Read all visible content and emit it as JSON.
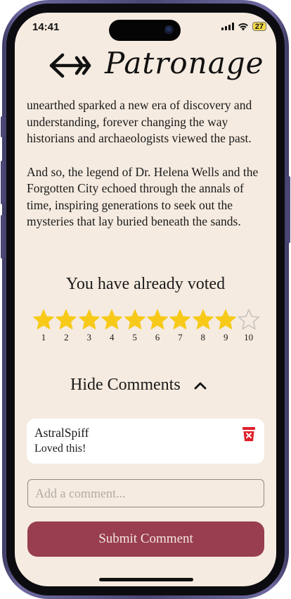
{
  "status_bar": {
    "time": "14:41",
    "battery": "27",
    "battery_color": "#f3d94a"
  },
  "header": {
    "title": "Patronage",
    "back_icon": "double-back-arrow-icon"
  },
  "story": {
    "paragraphs": [
      "unearthed sparked a new era of discovery and understanding, forever changing the way historians and archaeologists viewed the past.",
      "And so, the legend of Dr. Helena Wells and the Forgotten City echoed through the annals of time, inspiring generations to seek out the mysteries that lay buried beneath the sands."
    ]
  },
  "vote": {
    "status": "You have already voted"
  },
  "rating": {
    "value": 9,
    "max": 10,
    "filled_color": "#f7ca1a",
    "empty_color": "#c8c4c0",
    "labels": [
      "1",
      "2",
      "3",
      "4",
      "5",
      "6",
      "7",
      "8",
      "9",
      "10"
    ]
  },
  "comments": {
    "toggle_label": "Hide Comments",
    "toggle_icon": "chevron-up-icon",
    "items": [
      {
        "author": "AstralSpiff",
        "text": "Loved this!",
        "delete_icon": "trash-icon"
      }
    ],
    "input_placeholder": "Add a comment...",
    "input_value": "",
    "submit_label": "Submit Comment"
  },
  "colors": {
    "background": "#f5ebe0",
    "accent": "#983e50",
    "delete": "#e0202a"
  }
}
